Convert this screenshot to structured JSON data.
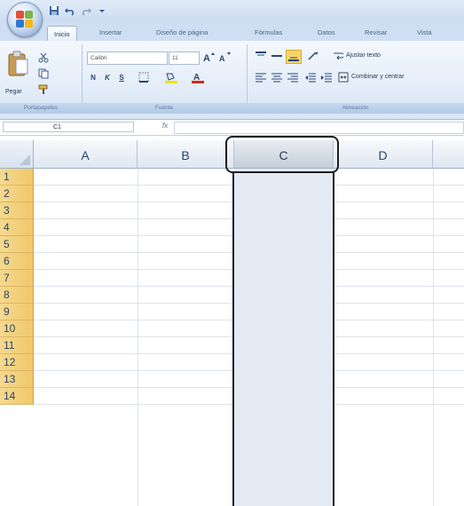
{
  "colors": {
    "row_header": "#efc86a",
    "selected_column": "#e4eaf3",
    "ribbon": "#d8e5f5",
    "highlight": "#1e1e1e"
  },
  "title_bar": {
    "qat_icons": [
      "save-icon",
      "undo-icon",
      "redo-icon",
      "qat-dropdown-icon"
    ]
  },
  "tabs": [
    "Inicio",
    "Insertar",
    "Diseño de página",
    "Fórmulas",
    "Datos",
    "Revisar",
    "Vista"
  ],
  "ribbon": {
    "clipboard": {
      "paste_label": "Pegar",
      "group_label": "Portapapeles"
    },
    "font": {
      "font_name": "Calibri",
      "font_size": "11",
      "group_label": "Fuente",
      "bold": "N",
      "italic": "K",
      "underline": "S"
    },
    "alignment": {
      "wrap_text": "Ajustar texto",
      "merge_center": "Combinar y centrar",
      "group_label": "Alineación"
    }
  },
  "formula_bar": {
    "name_box": "C1",
    "fx": "fx",
    "value": ""
  },
  "columns": [
    "A",
    "B",
    "C",
    "D"
  ],
  "selected_column": "C",
  "rows": [
    "1",
    "2",
    "3",
    "4",
    "5",
    "6",
    "7",
    "8",
    "9",
    "10",
    "11",
    "12",
    "13",
    "14"
  ]
}
